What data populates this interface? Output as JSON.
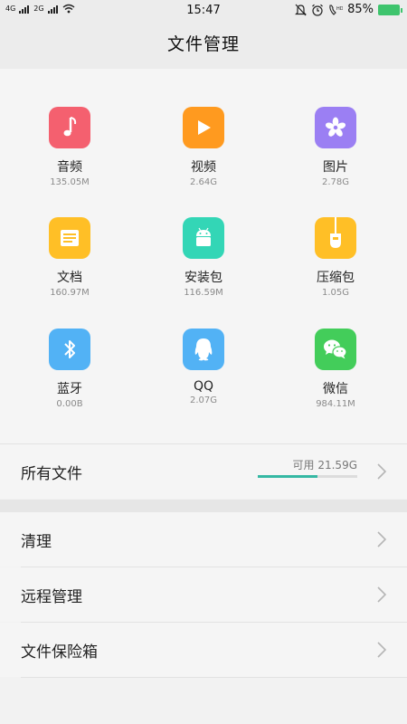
{
  "status": {
    "left_labels": [
      "4G",
      "2G"
    ],
    "time": "15:47",
    "battery": "85%"
  },
  "header": {
    "title": "文件管理"
  },
  "categories": [
    {
      "label": "音频",
      "size": "135.05M",
      "icon": "music-note-icon",
      "color": "#f4606f"
    },
    {
      "label": "视频",
      "size": "2.64G",
      "icon": "play-icon",
      "color": "#ff9a1f"
    },
    {
      "label": "图片",
      "size": "2.78G",
      "icon": "flower-icon",
      "color": "#9b7ff3"
    },
    {
      "label": "文档",
      "size": "160.97M",
      "icon": "document-icon",
      "color": "#ffbf26"
    },
    {
      "label": "安装包",
      "size": "116.59M",
      "icon": "android-icon",
      "color": "#33d6b6"
    },
    {
      "label": "压缩包",
      "size": "1.05G",
      "icon": "archive-icon",
      "color": "#ffbf26"
    },
    {
      "label": "蓝牙",
      "size": "0.00B",
      "icon": "bluetooth-icon",
      "color": "#52b2f5"
    },
    {
      "label": "QQ",
      "size": "2.07G",
      "icon": "qq-icon",
      "color": "#52b2f5"
    },
    {
      "label": "微信",
      "size": "984.11M",
      "icon": "wechat-icon",
      "color": "#43cd5a"
    }
  ],
  "all_files": {
    "label": "所有文件",
    "available": "可用 21.59G",
    "used_fraction": 0.6
  },
  "menu": [
    {
      "label": "清理"
    },
    {
      "label": "远程管理"
    },
    {
      "label": "文件保险箱"
    }
  ]
}
